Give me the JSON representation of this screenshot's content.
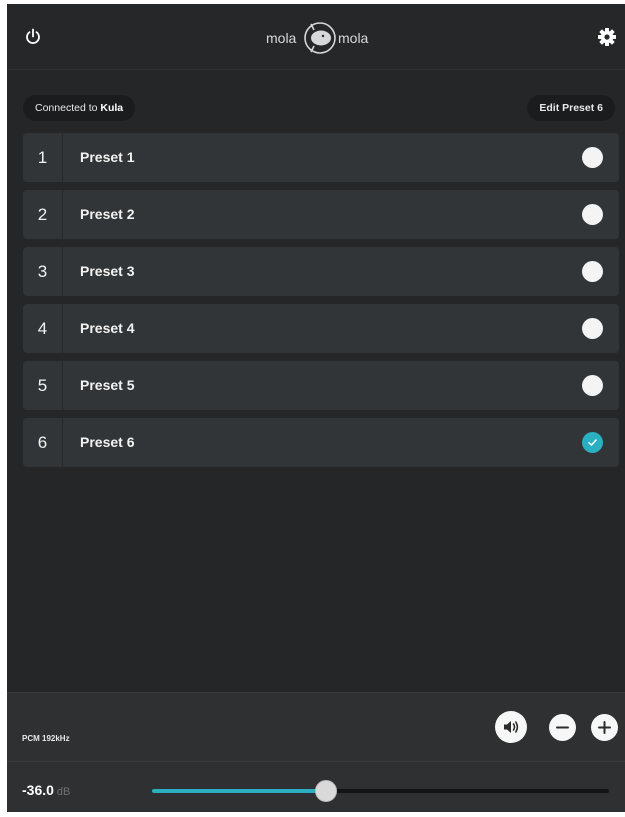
{
  "header": {
    "power_icon": "power-icon",
    "settings_icon": "gear-icon",
    "brand_left": "mola",
    "brand_right": "mola"
  },
  "connection": {
    "prefix": "Connected to ",
    "device": "Kula"
  },
  "edit_button": {
    "label": "Edit Preset 6"
  },
  "presets": [
    {
      "number": "1",
      "name": "Preset 1",
      "selected": false
    },
    {
      "number": "2",
      "name": "Preset 2",
      "selected": false
    },
    {
      "number": "3",
      "name": "Preset 3",
      "selected": false
    },
    {
      "number": "4",
      "name": "Preset 4",
      "selected": false
    },
    {
      "number": "5",
      "name": "Preset 5",
      "selected": false
    },
    {
      "number": "6",
      "name": "Preset 6",
      "selected": true
    }
  ],
  "footer": {
    "format": "PCM 192kHz",
    "mute_icon": "speaker-icon",
    "minus_icon": "minus-icon",
    "plus_icon": "plus-icon",
    "volume_value": "-36.0",
    "volume_unit": "dB",
    "slider_level": 0.38
  },
  "colors": {
    "accent": "#2ab0c1",
    "background": "#252627",
    "row": "#323537"
  }
}
